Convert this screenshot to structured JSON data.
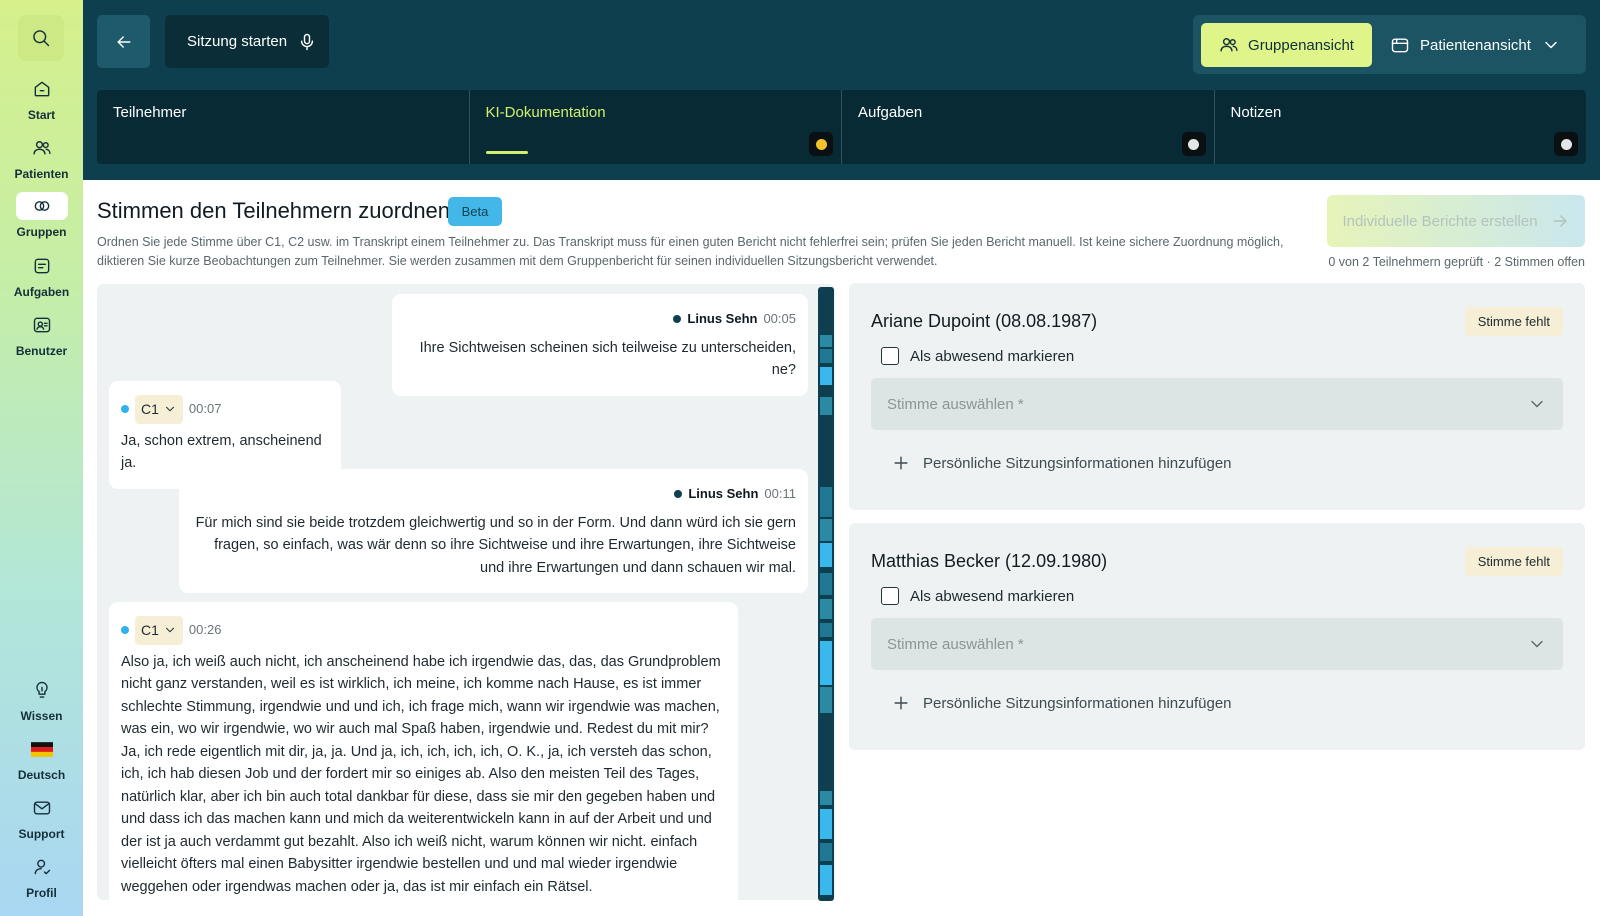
{
  "sidebar": {
    "items": [
      {
        "label": "Start",
        "icon": "home-icon"
      },
      {
        "label": "Patienten",
        "icon": "users-icon"
      },
      {
        "label": "Gruppen",
        "icon": "groups-icon"
      },
      {
        "label": "Aufgaben",
        "icon": "tasks-icon"
      },
      {
        "label": "Benutzer",
        "icon": "user-card-icon"
      }
    ],
    "bottom_items": [
      {
        "label": "Wissen",
        "icon": "lightbulb-icon"
      },
      {
        "label": "Deutsch",
        "icon": "german-flag-icon"
      },
      {
        "label": "Support",
        "icon": "mail-icon"
      },
      {
        "label": "Profil",
        "icon": "profile-icon"
      }
    ]
  },
  "header": {
    "session_button": "Sitzung starten",
    "group_view": "Gruppenansicht",
    "patient_view": "Patientenansicht",
    "tabs": [
      {
        "label": "Teilnehmer"
      },
      {
        "label": "KI-Dokumentation"
      },
      {
        "label": "Aufgaben"
      },
      {
        "label": "Notizen"
      }
    ]
  },
  "main": {
    "title": "Stimmen den Teilnehmern zuordnen",
    "beta": "Beta",
    "description": "Ordnen Sie jede Stimme über C1, C2 usw. im Transkript einem Teilnehmer zu. Das Transkript muss für einen guten Bericht nicht fehlerfrei sein; prüfen Sie jeden Bericht manuell. Ist keine sichere Zuordnung möglich, diktieren Sie kurze Beobachtungen zum Teilnehmer. Sie werden zusammen mit dem Gruppenbericht für seinen individuellen Sitzungsbericht verwendet.",
    "report_button": "Individuelle Berichte erstellen",
    "review_status": "0 von 2 Teilnehmern geprüft · 2 Stimmen offen"
  },
  "transcript": [
    {
      "speaker": "Linus Sehn",
      "time": "00:05",
      "text": "Ihre Sichtweisen scheinen sich teilweise zu unterscheiden, ne?"
    },
    {
      "voice": "C1",
      "time": "00:07",
      "text": "Ja, schon extrem, anscheinend ja."
    },
    {
      "speaker": "Linus Sehn",
      "time": "00:11",
      "text": "Für mich sind sie beide trotzdem gleichwertig und so in der Form. Und dann würd ich sie gern fragen, so einfach, was wär denn so ihre Sichtweise und ihre Erwartungen, ihre Sichtweise und ihre Erwartungen und dann schauen wir mal."
    },
    {
      "voice": "C1",
      "time": "00:26",
      "text": "Also ja, ich weiß auch nicht, ich anscheinend habe ich irgendwie das, das, das Grundproblem nicht ganz verstanden, weil es ist wirklich, ich meine, ich komme nach Hause, es ist immer schlechte Stimmung, irgendwie und und ich, ich frage mich, wann wir irgendwie was machen, was ein, wo wir irgendwie, wo wir auch mal Spaß haben, irgendwie und. Redest du mit mir? Ja, ich rede eigentlich mit dir, ja, ja. Und ja, ich, ich, ich, ich, O. K., ja, ich versteh das schon, ich, ich hab die­sen Job und der fordert mir so einiges ab. Also den meisten Teil des Tages, natürlich klar, aber ich bin auch total dankbar für diese, dass sie mir den gegeben haben und und dass ich das machen kann und mich da weiterentwickeln kann in auf der Arbeit und und der ist ja auch verdammt gut bezahlt. Also ich weiß nicht, warum können wir nicht. einfach vielleicht öfters mal einen Babysitter irgendwie bestellen und und mal wieder irgendwie weggehen oder irgendwas machen oder ja, das ist mir einfach ein Rätsel."
    }
  ],
  "participants": [
    {
      "name": "Ariane Dupoint (08.08.1987)",
      "badge": "Stimme fehlt",
      "absent_label": "Als abwesend markieren",
      "voice_placeholder": "Stimme auswählen *",
      "add_info": "Persönliche Sitzungsinformationen hinzufügen"
    },
    {
      "name": "Matthias Becker (12.09.1980)",
      "badge": "Stimme fehlt",
      "absent_label": "Als abwesend markieren",
      "voice_placeholder": "Stimme auswählen *",
      "add_info": "Persönliche Sitzungsinformationen hinzufügen"
    }
  ],
  "colors": {
    "header_bg": "#0e3f4e",
    "accent_lime": "#dff58a",
    "beta_blue": "#43b8e8",
    "badge_bg": "#f6efd6"
  }
}
